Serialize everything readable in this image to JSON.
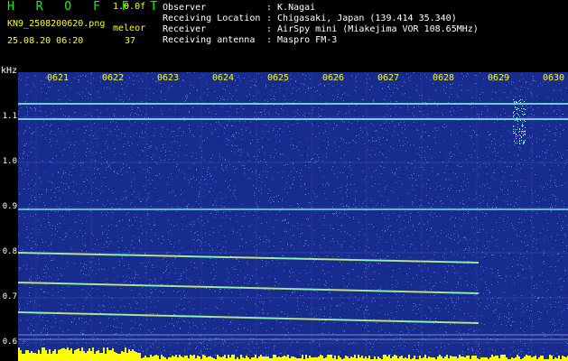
{
  "header": {
    "logo": "H R O F F T",
    "version": "1.0.0f",
    "filename": "KN9_2508200620.png",
    "mode": "meleor",
    "datetime": "25.08.20 06:20",
    "count": "37"
  },
  "info": [
    {
      "key": "Observer",
      "value": ": K.Nagai"
    },
    {
      "key": "Receiving Location",
      "value": ": Chigasaki, Japan (139.414 35.340)"
    },
    {
      "key": "Receiver",
      "value": ": AirSpy mini (Miakejima VOR 108.65MHz)"
    },
    {
      "key": "Receiving antenna",
      "value": ": Maspro FM-3"
    }
  ],
  "axis": {
    "unit": "kHz",
    "y_ticks": [
      "1.1",
      "1.0",
      "0.9",
      "0.8",
      "0.7",
      "0.6"
    ],
    "x_ticks": [
      "0621",
      "0622",
      "0623",
      "0624",
      "0625",
      "0626",
      "0627",
      "0628",
      "0629",
      "0630"
    ]
  },
  "colors": {
    "background": "#000000",
    "noise_base": "#1a2fa0",
    "trace": "#7fffd0",
    "label": "#ffff00"
  }
}
